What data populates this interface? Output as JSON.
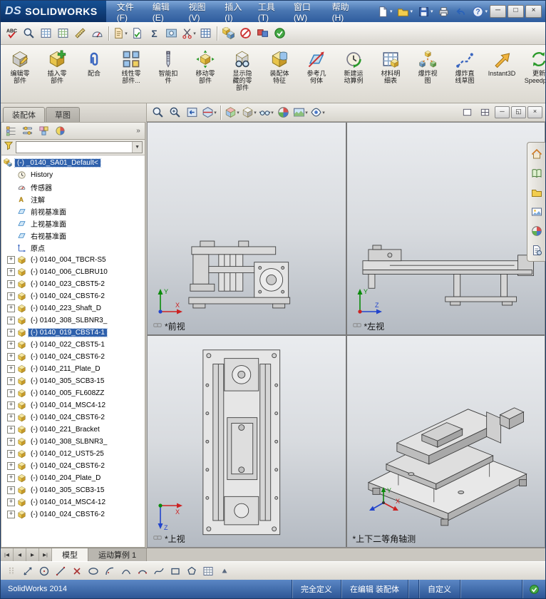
{
  "titlebar": {
    "logo": {
      "ds": "DS",
      "name": "SOLIDWORKS"
    },
    "menus": [
      "文件(F)",
      "编辑(E)",
      "视图(V)",
      "插入(I)",
      "工具(T)",
      "窗口(W)",
      "帮助(H)"
    ],
    "quick_icons": [
      {
        "name": "new-document-button",
        "kind": "page",
        "dropdown": true
      },
      {
        "name": "open-button",
        "kind": "folder",
        "dropdown": true
      },
      {
        "name": "save-button",
        "kind": "floppy",
        "dropdown": true
      },
      {
        "name": "print-button",
        "kind": "printer",
        "dropdown": false
      },
      {
        "name": "undo-button",
        "kind": "undo",
        "dropdown": false
      },
      {
        "name": "help-button",
        "kind": "help",
        "dropdown": true
      }
    ],
    "window_buttons": [
      {
        "name": "minimize-button",
        "glyph": "─"
      },
      {
        "name": "maximize-button",
        "glyph": "□"
      },
      {
        "name": "close-button",
        "glyph": "×"
      }
    ]
  },
  "toolbar2": [
    {
      "name": "spell-checker-icon",
      "kind": "abc"
    },
    {
      "name": "search-icon",
      "kind": "magnifier"
    },
    {
      "name": "design-table-icon",
      "kind": "grid",
      "color": "#7aa0c8"
    },
    {
      "name": "hole-table-icon",
      "kind": "grid",
      "color": "#8ab87a"
    },
    {
      "name": "measure-icon",
      "kind": "measure"
    },
    {
      "name": "mass-properties-icon",
      "kind": "gauge"
    },
    {
      "kind": "sep"
    },
    {
      "name": "document-properties-icon",
      "kind": "page2",
      "dropdown": true
    },
    {
      "name": "design-checker-icon",
      "kind": "checkpage"
    },
    {
      "name": "equations-icon",
      "kind": "sigma"
    },
    {
      "name": "visualize-icon",
      "kind": "xray"
    },
    {
      "name": "trim-icon",
      "kind": "scissors",
      "dropdown": true
    },
    {
      "name": "bom-table-icon",
      "kind": "grid",
      "color": "#4a78b0"
    },
    {
      "kind": "sep"
    },
    {
      "name": "compare-documents-icon",
      "kind": "cube2"
    },
    {
      "name": "deviation-analysis-icon",
      "kind": "noentry"
    },
    {
      "name": "compare-results-icon",
      "kind": "redblue"
    },
    {
      "name": "verification-icon",
      "kind": "greenball"
    }
  ],
  "command_manager": [
    {
      "name": "edit-component-button",
      "label": "编辑零\n部件",
      "icon": "cmedit"
    },
    {
      "name": "insert-components-button",
      "label": "插入零\n部件",
      "icon": "cminsert"
    },
    {
      "name": "mate-button",
      "label": "配合",
      "icon": "cmmate"
    },
    {
      "name": "linear-component-pattern-button",
      "label": "线性零\n部件...",
      "icon": "cmpattern"
    },
    {
      "name": "smart-fasteners-button",
      "label": "智能扣\n件",
      "icon": "cmfastener"
    },
    {
      "name": "move-component-button",
      "label": "移动零\n部件",
      "icon": "cmmove"
    },
    {
      "name": "show-hidden-components-button",
      "label": "显示隐\n藏的零\n部件",
      "icon": "cmhidden"
    },
    {
      "name": "assembly-features-button",
      "label": "装配体\n特征",
      "icon": "cmfeature"
    },
    {
      "name": "reference-geometry-button",
      "label": "参考几\n何体",
      "icon": "cmrefgeo"
    },
    {
      "name": "new-motion-study-button",
      "label": "新建运\n动算例",
      "icon": "cmmotion"
    },
    {
      "name": "bill-of-materials-button",
      "label": "材料明\n细表",
      "icon": "cmbom"
    },
    {
      "name": "exploded-view-button",
      "label": "爆炸视\n图",
      "icon": "cmexplode"
    },
    {
      "name": "explode-line-sketch-button",
      "label": "爆炸直\n线草图",
      "icon": "cmexplodeline"
    },
    {
      "name": "instant3d-button",
      "label": "Instant3D",
      "icon": "cminstant3d"
    },
    {
      "name": "update-speedpak-button",
      "label": "更新\nSpeedpak",
      "icon": "cmspeedpak"
    }
  ],
  "panel_tabs": [
    {
      "label": "装配体",
      "active": true
    },
    {
      "label": "草图",
      "active": false
    }
  ],
  "left_panel": {
    "tabs": [
      {
        "name": "featuremanager-tab",
        "kind": "treeicon"
      },
      {
        "name": "propertymanager-tab",
        "kind": "propicon"
      },
      {
        "name": "configurationmanager-tab",
        "kind": "cfgicon"
      },
      {
        "name": "displaymanager-tab",
        "kind": "dispicon"
      },
      {
        "name": "panel-expand-button",
        "glyph": "»"
      }
    ]
  },
  "tree": {
    "items": [
      {
        "label": "(-) _0140_SA01_Default<",
        "icon": "asm",
        "level": 0,
        "selected": true
      },
      {
        "label": "History",
        "icon": "history",
        "level": 1
      },
      {
        "label": "传感器",
        "icon": "sensors",
        "level": 1
      },
      {
        "label": "注解",
        "icon": "annotations",
        "level": 1
      },
      {
        "label": "前视基准面",
        "icon": "plane",
        "level": 1
      },
      {
        "label": "上视基准面",
        "icon": "plane",
        "level": 1
      },
      {
        "label": "右视基准面",
        "icon": "plane",
        "level": 1
      },
      {
        "label": "原点",
        "icon": "origin",
        "level": 1
      },
      {
        "label": "(-) 0140_004_TBCR-S5",
        "icon": "part",
        "level": 1,
        "plus": true
      },
      {
        "label": "(-) 0140_006_CLBRU10",
        "icon": "part",
        "level": 1,
        "plus": true
      },
      {
        "label": "(-) 0140_023_CBST5-2",
        "icon": "part",
        "level": 1,
        "plus": true
      },
      {
        "label": "(-) 0140_024_CBST6-2",
        "icon": "part",
        "level": 1,
        "plus": true
      },
      {
        "label": "(-) 0140_223_Shaft_D",
        "icon": "part",
        "level": 1,
        "plus": true
      },
      {
        "label": "(-) 0140_308_SLBNR3_",
        "icon": "part",
        "level": 1,
        "plus": true
      },
      {
        "label": "(-) 0140_019_CBST4-1",
        "icon": "part",
        "level": 1,
        "plus": true,
        "selected": true
      },
      {
        "label": "(-) 0140_022_CBST5-1",
        "icon": "part",
        "level": 1,
        "plus": true
      },
      {
        "label": "(-) 0140_024_CBST6-2",
        "icon": "part",
        "level": 1,
        "plus": true
      },
      {
        "label": "(-) 0140_211_Plate_D",
        "icon": "part",
        "level": 1,
        "plus": true
      },
      {
        "label": "(-) 0140_305_SCB3-15",
        "icon": "part",
        "level": 1,
        "plus": true
      },
      {
        "label": "(-) 0140_005_FL608ZZ",
        "icon": "part",
        "level": 1,
        "plus": true
      },
      {
        "label": "(-) 0140_014_MSC4-12",
        "icon": "part",
        "level": 1,
        "plus": true
      },
      {
        "label": "(-) 0140_024_CBST6-2",
        "icon": "part",
        "level": 1,
        "plus": true
      },
      {
        "label": "(-) 0140_221_Bracket",
        "icon": "part",
        "level": 1,
        "plus": true
      },
      {
        "label": "(-) 0140_308_SLBNR3_",
        "icon": "part",
        "level": 1,
        "plus": true
      },
      {
        "label": "(-) 0140_012_UST5-25",
        "icon": "part",
        "level": 1,
        "plus": true
      },
      {
        "label": "(-) 0140_024_CBST6-2",
        "icon": "part",
        "level": 1,
        "plus": true
      },
      {
        "label": "(-) 0140_204_Plate_D",
        "icon": "part",
        "level": 1,
        "plus": true
      },
      {
        "label": "(-) 0140_305_SCB3-15",
        "icon": "part",
        "level": 1,
        "plus": true
      },
      {
        "label": "(-) 0140_014_MSC4-12",
        "icon": "part",
        "level": 1,
        "plus": true
      },
      {
        "label": "(-) 0140_024_CBST6-2",
        "icon": "part",
        "level": 1,
        "plus": true
      }
    ]
  },
  "viewport": {
    "hud_icons": [
      {
        "name": "zoom-fit-icon",
        "kind": "magnifier"
      },
      {
        "name": "zoom-area-icon",
        "kind": "magnifierplus"
      },
      {
        "name": "previous-view-icon",
        "kind": "prevview"
      },
      {
        "name": "section-view-icon",
        "kind": "section",
        "dropdown": true
      },
      {
        "kind": "sep"
      },
      {
        "name": "view-orientation-icon",
        "kind": "orientcube",
        "dropdown": true
      },
      {
        "name": "display-style-icon",
        "kind": "displaycube",
        "dropdown": true
      },
      {
        "name": "hide-show-items-icon",
        "kind": "glasses",
        "dropdown": true
      },
      {
        "name": "edit-appearance-icon",
        "kind": "ballrgb"
      },
      {
        "name": "apply-scene-icon",
        "kind": "scene",
        "dropdown": true
      },
      {
        "name": "view-settings-icon",
        "kind": "viewsettings",
        "dropdown": true
      }
    ],
    "window_icons": [
      {
        "name": "viewport-single-icon",
        "kind": "pane1"
      },
      {
        "name": "viewport-four-icon",
        "kind": "pane4"
      }
    ],
    "window_buttons": [
      {
        "name": "document-minimize-button",
        "glyph": "─"
      },
      {
        "name": "document-restore-button",
        "glyph": "◱"
      },
      {
        "name": "document-close-button",
        "glyph": "×"
      }
    ],
    "views": [
      {
        "label": "*前视"
      },
      {
        "label": "*左视"
      },
      {
        "label": "*上视"
      },
      {
        "label": "*上下二等角轴测"
      }
    ]
  },
  "taskpane": [
    {
      "name": "solidworks-resources-icon",
      "kind": "house"
    },
    {
      "name": "design-library-icon",
      "kind": "library"
    },
    {
      "name": "file-explorer-icon",
      "kind": "folder"
    },
    {
      "name": "view-palette-icon",
      "kind": "palette"
    },
    {
      "name": "appearances-icon",
      "kind": "ballrgb"
    },
    {
      "name": "custom-properties-icon",
      "kind": "props"
    }
  ],
  "bottom_bar": {
    "nav": [
      "|◀",
      "◀",
      "▶",
      "▶|"
    ],
    "tabs": [
      {
        "label": "模型",
        "active": true
      },
      {
        "label": "运动算例 1",
        "active": false
      }
    ]
  },
  "sketch_toolbar": [
    {
      "name": "toolbar-drag-handle",
      "kind": "handle"
    },
    {
      "name": "smart-dimension-icon",
      "kind": "dimension"
    },
    {
      "name": "circle-icon",
      "kind": "circle"
    },
    {
      "name": "line-icon",
      "kind": "line"
    },
    {
      "name": "erase-icon",
      "kind": "cross"
    },
    {
      "name": "ellipse-icon",
      "kind": "ellipse"
    },
    {
      "name": "centerpoint-arc-icon",
      "kind": "arc1"
    },
    {
      "name": "tangent-arc-icon",
      "kind": "arc2"
    },
    {
      "name": "threepoint-arc-icon",
      "kind": "arc3"
    },
    {
      "name": "spline-icon",
      "kind": "spline"
    },
    {
      "name": "rectangle-icon",
      "kind": "rect"
    },
    {
      "name": "polygon-icon",
      "kind": "polygon"
    },
    {
      "name": "linear-pattern-icon",
      "kind": "grid",
      "color": "#8898a8"
    },
    {
      "name": "more-tools-icon",
      "kind": "smalltri"
    }
  ],
  "statusbar": {
    "app": "SolidWorks 2014",
    "define_status": "完全定义",
    "edit_status": "在编辑 装配体",
    "custom_label": "自定义"
  }
}
